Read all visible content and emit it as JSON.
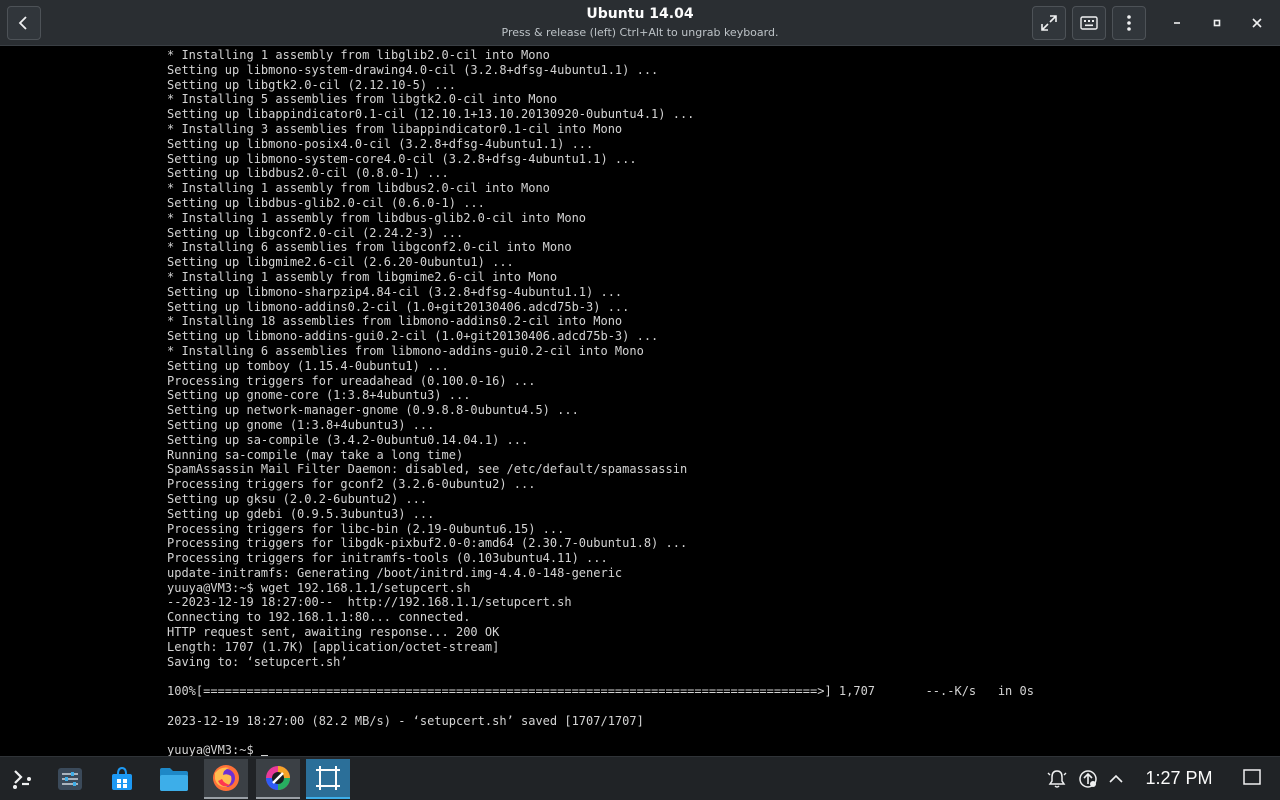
{
  "window": {
    "title": "Ubuntu 14.04",
    "subtitle": "Press & release (left) Ctrl+Alt to ungrab keyboard."
  },
  "titlebar_buttons": {
    "back": "back-arrow-icon",
    "fullscreen": "fullscreen-icon",
    "keyboard": "keyboard-icon",
    "menu": "kebab-menu-icon",
    "minimize": "minimize-icon",
    "maximize": "maximize-icon",
    "close": "close-icon"
  },
  "terminal": {
    "lines": [
      "* Installing 1 assembly from libglib2.0-cil into Mono",
      "Setting up libmono-system-drawing4.0-cil (3.2.8+dfsg-4ubuntu1.1) ...",
      "Setting up libgtk2.0-cil (2.12.10-5) ...",
      "* Installing 5 assemblies from libgtk2.0-cil into Mono",
      "Setting up libappindicator0.1-cil (12.10.1+13.10.20130920-0ubuntu4.1) ...",
      "* Installing 3 assemblies from libappindicator0.1-cil into Mono",
      "Setting up libmono-posix4.0-cil (3.2.8+dfsg-4ubuntu1.1) ...",
      "Setting up libmono-system-core4.0-cil (3.2.8+dfsg-4ubuntu1.1) ...",
      "Setting up libdbus2.0-cil (0.8.0-1) ...",
      "* Installing 1 assembly from libdbus2.0-cil into Mono",
      "Setting up libdbus-glib2.0-cil (0.6.0-1) ...",
      "* Installing 1 assembly from libdbus-glib2.0-cil into Mono",
      "Setting up libgconf2.0-cil (2.24.2-3) ...",
      "* Installing 6 assemblies from libgconf2.0-cil into Mono",
      "Setting up libgmime2.6-cil (2.6.20-0ubuntu1) ...",
      "* Installing 1 assembly from libgmime2.6-cil into Mono",
      "Setting up libmono-sharpzip4.84-cil (3.2.8+dfsg-4ubuntu1.1) ...",
      "Setting up libmono-addins0.2-cil (1.0+git20130406.adcd75b-3) ...",
      "* Installing 18 assemblies from libmono-addins0.2-cil into Mono",
      "Setting up libmono-addins-gui0.2-cil (1.0+git20130406.adcd75b-3) ...",
      "* Installing 6 assemblies from libmono-addins-gui0.2-cil into Mono",
      "Setting up tomboy (1.15.4-0ubuntu1) ...",
      "Processing triggers for ureadahead (0.100.0-16) ...",
      "Setting up gnome-core (1:3.8+4ubuntu3) ...",
      "Setting up network-manager-gnome (0.9.8.8-0ubuntu4.5) ...",
      "Setting up gnome (1:3.8+4ubuntu3) ...",
      "Setting up sa-compile (3.4.2-0ubuntu0.14.04.1) ...",
      "Running sa-compile (may take a long time)",
      "SpamAssassin Mail Filter Daemon: disabled, see /etc/default/spamassassin",
      "Processing triggers for gconf2 (3.2.6-0ubuntu2) ...",
      "Setting up gksu (2.0.2-6ubuntu2) ...",
      "Setting up gdebi (0.9.5.3ubuntu3) ...",
      "Processing triggers for libc-bin (2.19-0ubuntu6.15) ...",
      "Processing triggers for libgdk-pixbuf2.0-0:amd64 (2.30.7-0ubuntu1.8) ...",
      "Processing triggers for initramfs-tools (0.103ubuntu4.11) ...",
      "update-initramfs: Generating /boot/initrd.img-4.4.0-148-generic",
      "yuuya@VM3:~$ wget 192.168.1.1/setupcert.sh",
      "--2023-12-19 18:27:00--  http://192.168.1.1/setupcert.sh",
      "Connecting to 192.168.1.1:80... connected.",
      "HTTP request sent, awaiting response... 200 OK",
      "Length: 1707 (1.7K) [application/octet-stream]",
      "Saving to: ‘setupcert.sh’",
      "",
      "100%[=====================================================================================>] 1,707       --.-K/s   in 0s",
      "",
      "2023-12-19 18:27:00 (82.2 MB/s) - ‘setupcert.sh’ saved [1707/1707]",
      ""
    ],
    "prompt": "yuuya@VM3:~$ "
  },
  "taskbar": {
    "items": [
      {
        "name": "launcher",
        "icon": "application-launcher-icon"
      },
      {
        "name": "system-settings",
        "icon": "settings-sliders-icon"
      },
      {
        "name": "discover",
        "icon": "store-bag-icon"
      },
      {
        "name": "file-manager",
        "icon": "folder-icon"
      },
      {
        "name": "firefox",
        "icon": "firefox-icon"
      },
      {
        "name": "color-app",
        "icon": "color-wheel-icon"
      },
      {
        "name": "vm-window",
        "icon": "virt-manager-icon"
      }
    ],
    "tray": {
      "notifications": "bell-icon",
      "updates": "update-icon",
      "expand": "chevron-up-icon"
    },
    "clock": "1:27 PM",
    "show_desktop": "show-desktop-icon"
  }
}
